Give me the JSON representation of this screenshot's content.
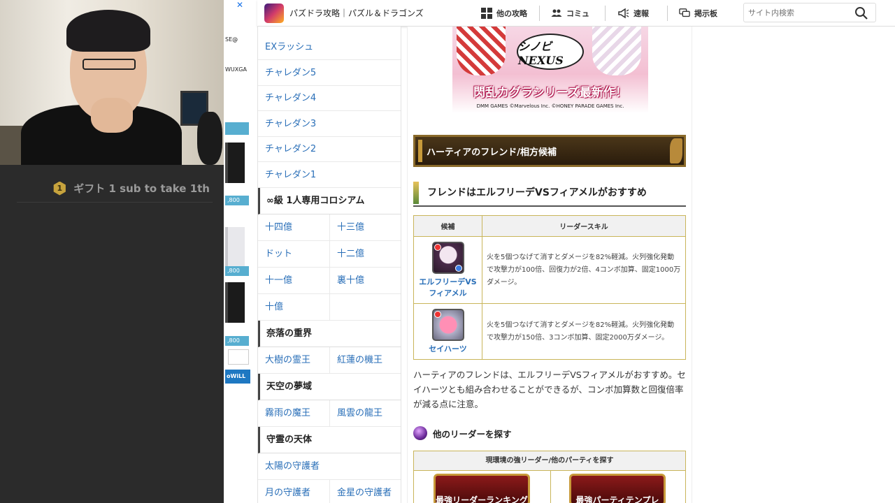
{
  "stream": {
    "gift_badge": "1",
    "gift_text": "ギフト 1 sub to take 1th"
  },
  "ad": {
    "close": "✕",
    "txt1": "SE@",
    "txt2": "WUXGA",
    "price": ",800",
    "logo": "oWiLL"
  },
  "header": {
    "title": "パズドラ攻略｜パズル＆ドラゴンズ",
    "nav": [
      {
        "label": "他の攻略",
        "icon": "grid-icon"
      },
      {
        "label": "コミュ",
        "icon": "users-icon"
      },
      {
        "label": "速報",
        "icon": "megaphone-icon"
      },
      {
        "label": "掲示板",
        "icon": "chat-icon"
      }
    ],
    "search_placeholder": "サイト内検索"
  },
  "sidebar": {
    "links": [
      "EXラッシュ",
      "チャレダン5",
      "チャレダン4",
      "チャレダン3",
      "チャレダン2",
      "チャレダン1"
    ],
    "colosseum_head": "∞級 1人専用コロシアム",
    "colosseum_rows": [
      [
        "十四億",
        "十三億"
      ],
      [
        "ドット",
        "十二億"
      ],
      [
        "十一億",
        "裏十億"
      ],
      [
        "十億",
        ""
      ]
    ],
    "head_naraku": "奈落の重界",
    "naraku_row": [
      "大樹の霊王",
      "紅蓮の機王"
    ],
    "head_tenku": "天空の夢域",
    "tenku_row": [
      "霧雨の魔王",
      "風雲の龍王"
    ],
    "head_shurei": "守霊の天体",
    "shurei_link": "太陽の守護者",
    "shurei_row": [
      "月の守護者",
      "金星の守護者"
    ]
  },
  "main": {
    "banner_logo": "シノビ NEXUS",
    "banner_title": "閃乱カグラシリーズ最新作！",
    "banner_credit": "DMM GAMES ©Marvelous Inc. ©HONEY PARADE GAMES Inc.",
    "section_heading": "ハーティアのフレンド/相方候補",
    "sub_heading": "フレンドはエルフリーデVSフィアメルがおすすめ",
    "table_headers": [
      "候補",
      "リーダースキル"
    ],
    "table_rows": [
      {
        "name": "エルフリーデVS\nフィアメル",
        "skill": "火を5個つなげて消すとダメージを82%軽減。火列強化発動で攻撃力が100倍、回復力が2倍、4コンボ加算、固定1000万ダメージ。"
      },
      {
        "name": "セイハーツ",
        "skill": "火を5個つなげて消すとダメージを82%軽減。火列強化発動で攻撃力が150倍、3コンボ加算、固定2000万ダメージ。"
      }
    ],
    "body_text": "ハーティアのフレンドは、エルフリーデVSフィアメルがおすすめ。セイハーツとも組み合わせることができるが、コンボ加算数と回復倍率が減る点に注意。",
    "leader_heading": "他のリーダーを探す",
    "env_heading": "現環境の強リーダー/他のパーティを探す",
    "env_buttons": [
      "最強リーダーランキング",
      "最強パーティテンプレ"
    ]
  }
}
